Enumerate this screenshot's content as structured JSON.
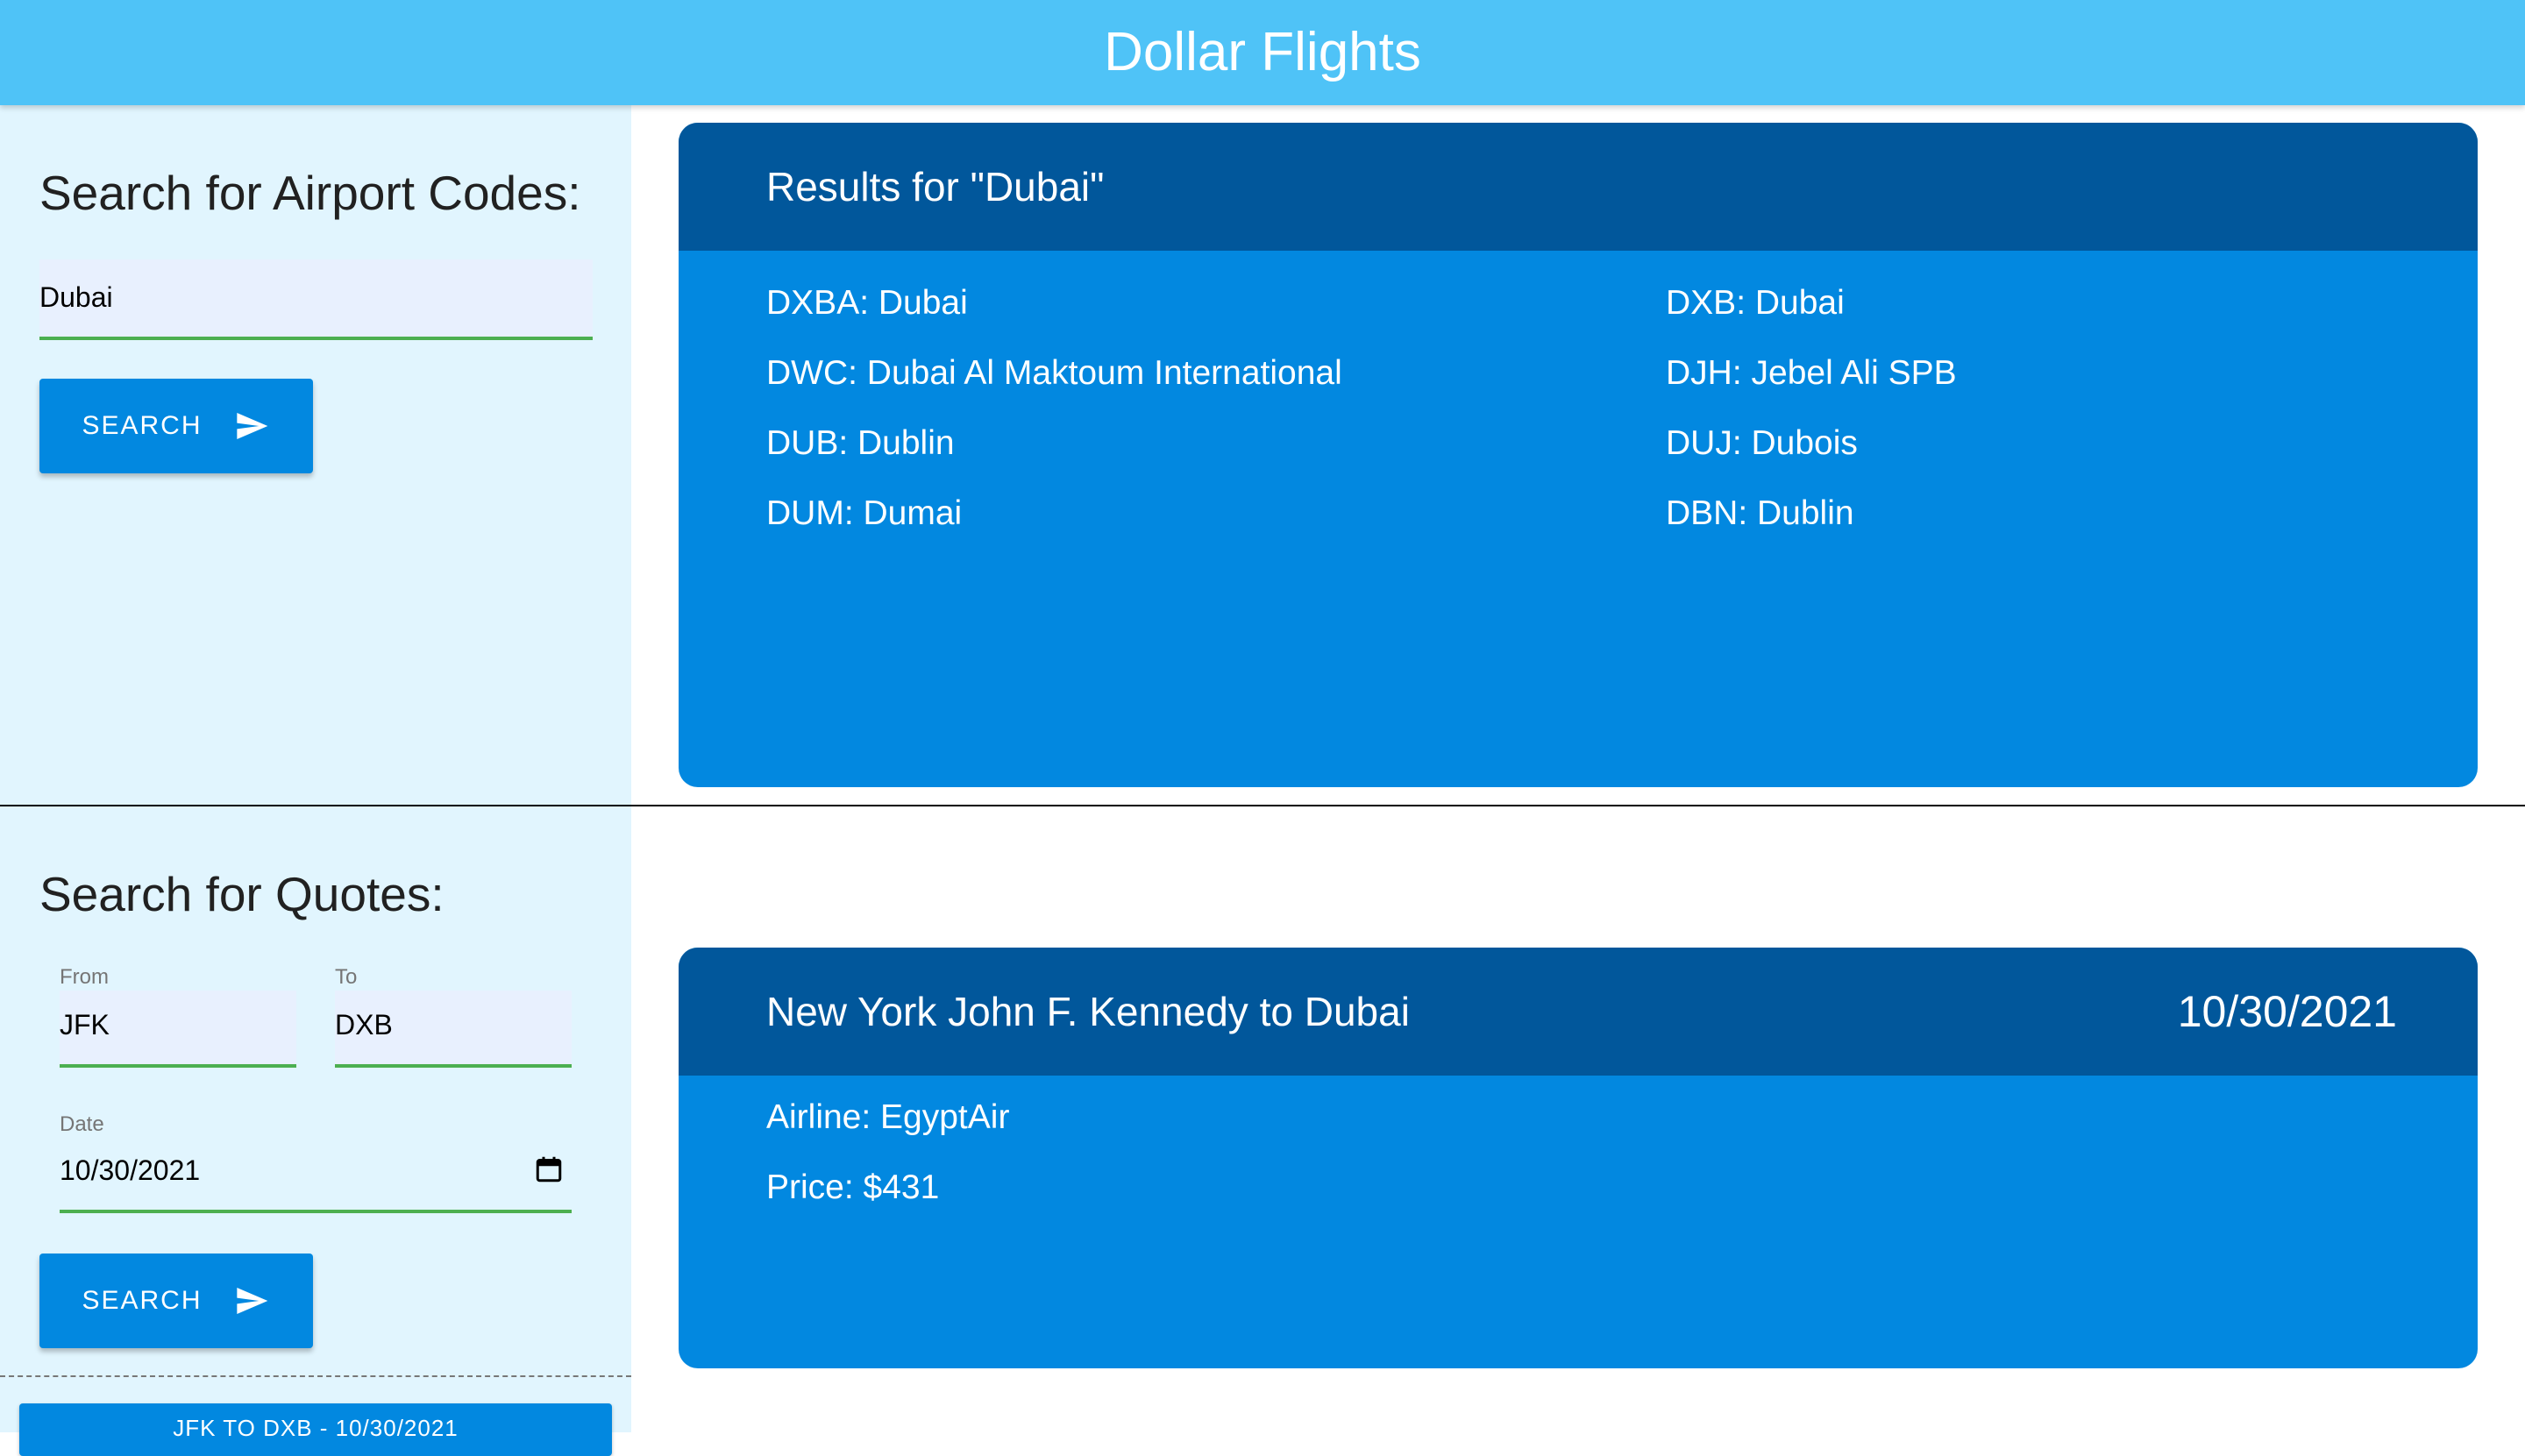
{
  "header": {
    "title": "Dollar Flights"
  },
  "airport_search": {
    "title": "Search for Airport Codes:",
    "query_value": "Dubai",
    "search_label": "SEARCH"
  },
  "airport_results": {
    "title": "Results for \"Dubai\"",
    "items": [
      "DXBA: Dubai",
      "DXB: Dubai",
      "DWC: Dubai Al Maktoum International",
      "DJH: Jebel Ali SPB",
      "DUB: Dublin",
      "DUJ: Dubois",
      "DUM: Dumai",
      "DBN: Dublin"
    ]
  },
  "quote_search": {
    "title": "Search for Quotes:",
    "from_label": "From",
    "from_value": "JFK",
    "to_label": "To",
    "to_value": "DXB",
    "date_label": "Date",
    "date_value": "10/30/2021",
    "search_label": "SEARCH"
  },
  "history": {
    "items": [
      "JFK TO DXB - 10/30/2021"
    ]
  },
  "quote_result": {
    "route": "New York John F. Kennedy to Dubai",
    "date": "10/30/2021",
    "airline": "Airline: EgyptAir",
    "price": "Price: $431"
  },
  "colors": {
    "header_bg": "#4fc3f7",
    "panel_bg": "#e1f5fe",
    "card_bg": "#0288e0",
    "card_header_bg": "#01579b",
    "field_underline": "#4caf50"
  },
  "icons": {
    "search_button_icon": "send-icon",
    "date_picker_icon": "calendar-icon"
  }
}
